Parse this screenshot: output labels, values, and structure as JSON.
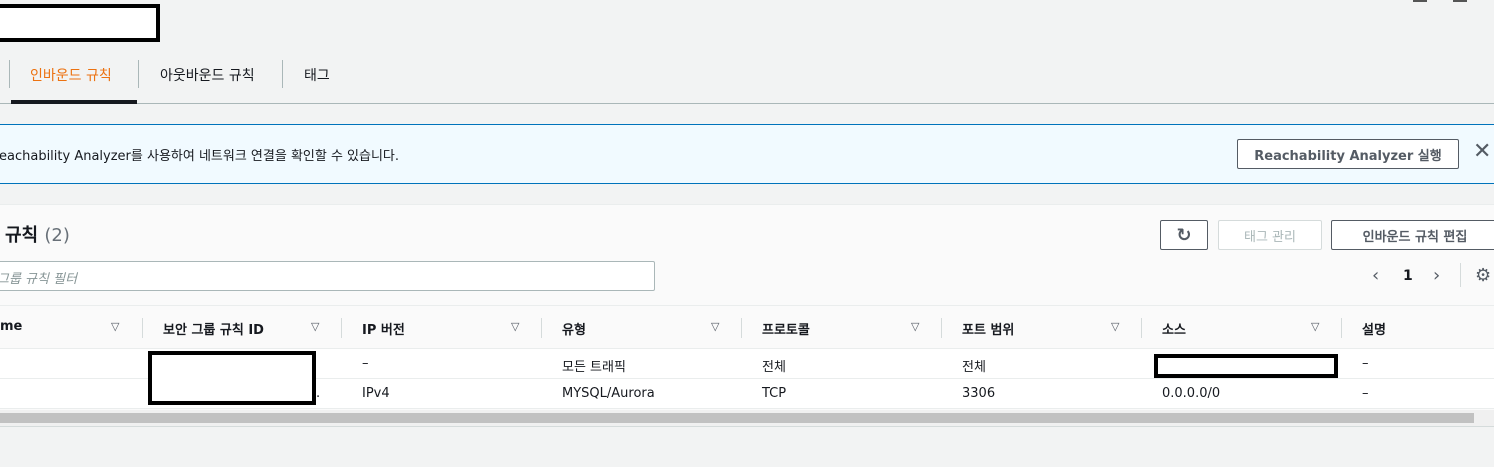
{
  "tabs": [
    {
      "label": "인바운드 규칙",
      "active": true
    },
    {
      "label": "아웃바운드 규칙",
      "active": false
    },
    {
      "label": "태그",
      "active": false
    }
  ],
  "flash": {
    "text": "eachability Analyzer를 사용하여 네트워크 연결을 확인할 수 있습니다.",
    "button_label": "Reachability Analyzer 실행",
    "close_icon": "close-icon"
  },
  "rules_panel": {
    "title": "규칙",
    "count": "(2)",
    "refresh_icon": "refresh-icon",
    "manage_tags_label": "태그 관리",
    "edit_rules_label": "인바운드 규칙 편집",
    "filter_placeholder": "그룹 규칙 필터",
    "page": "1"
  },
  "table": {
    "columns": [
      "me",
      "보안 그룹 규칙 ID",
      "IP 버전",
      "유형",
      "프로토콜",
      "포트 범위",
      "소스",
      "설명"
    ],
    "rows": [
      {
        "name": "",
        "rule_id": "",
        "ip_version": "–",
        "type": "모든 트래픽",
        "protocol": "전체",
        "port_range": "전체",
        "source": "",
        "description": "–"
      },
      {
        "name": "",
        "rule_id": ".",
        "ip_version": "IPv4",
        "type": "MYSQL/Aurora",
        "protocol": "TCP",
        "port_range": "3306",
        "source": "0.0.0.0/0",
        "description": "–"
      }
    ]
  },
  "colors": {
    "accent": "#ec7211",
    "info_border": "#0073bb",
    "info_bg": "#f1faff"
  }
}
